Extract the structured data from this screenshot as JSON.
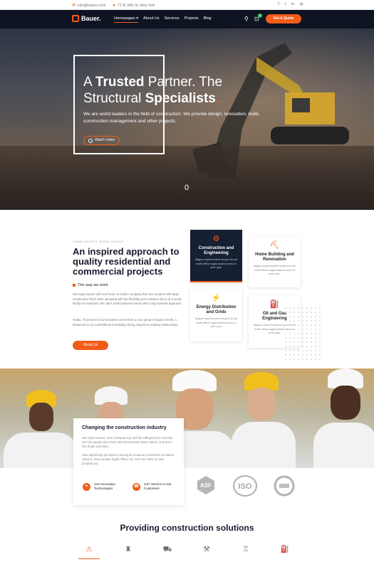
{
  "topbar": {
    "email": "info@bauerx.com",
    "address": "72 W 34th St, New York",
    "social": [
      "f",
      "t",
      "in",
      "ig"
    ]
  },
  "header": {
    "logo": "Bauer.",
    "nav": [
      "Homepages",
      "About Us",
      "Services",
      "Projects",
      "Blog"
    ],
    "cart_count": "0",
    "quote_label": "Get A Quote"
  },
  "hero": {
    "title_a": "A ",
    "title_b": "Trusted",
    "title_c": " Partner. The",
    "title_d": "Structural ",
    "title_e": "Specialists",
    "title_f": ".",
    "subtitle": "We are world leaders in the field of construction. We provide design, renovation, build, construction management and other projects.",
    "watch_label": "Watch Video",
    "slide_indicator": "0"
  },
  "about": {
    "eyebrow": "THINK SAFETY. WORK SAFELY.",
    "title_a": "An inspired approach to quality ",
    "title_b": "residential",
    "title_c": " and ",
    "title_d": "commercial",
    "title_e": " projects",
    "way_title": "The way we work",
    "para1": "We began Bauer with one focus: to build a company that can compete with large construction firms while operating with the flexibility and customer-focus of a small, family-run business. We call it small business values with a big business approach.",
    "para2": "Today, 75 percent of our business comes from a core group of legacy clients; a testament to our commitment to building strong, long-term working relationships.",
    "button": "About Us"
  },
  "services": [
    {
      "name": "Construction and Engineering",
      "desc": "Magna reprehenderit tempor do elit mollit officia fugiat ullamco duis ex aute quis."
    },
    {
      "name": "Home Building and Renovation",
      "desc": "Magna reprehenderit tempor do elit mollit officia fugiat ullamco duis ex aute quis."
    },
    {
      "name": "Energy Distribution and Grids",
      "desc": "Magna reprehenderit tempor do elit mollit officia fugiat ullamco duis ex aute quis."
    },
    {
      "name": "Oil and Gas Engineering",
      "desc": "Magna reprehenderit tempor do elit mollit officia fugiat ullamco duis ex aute quis."
    }
  ],
  "change": {
    "title": "Changing the construction industry",
    "p1": "We value respect, trust, transparency and the willingness to innovate. We hire people who share and demonstrate these values, and won't hire those who don't.",
    "p2": "Sunt adipisicing qui laboris consequat occaecat consectetur do labore culpa et. Duis pariatur fugiat officia nisi. Sint non minim ut quis proident qui.",
    "feat1": "Use Innovative Technologies",
    "feat2": "24/7 Service to Our Customers"
  },
  "badges": [
    "ASF",
    "ISO",
    "CERT"
  ],
  "solutions": {
    "title_a": "Providing ",
    "title_b": "construction",
    "title_c": " solutions"
  },
  "colors": {
    "accent": "#f25c19",
    "dark": "#0e1422",
    "card_dark": "#162033"
  }
}
